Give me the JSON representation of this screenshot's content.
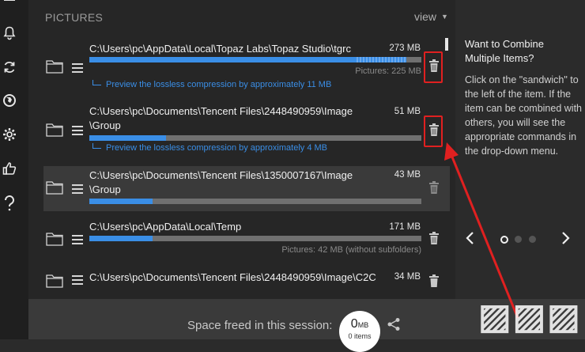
{
  "section": {
    "title": "PICTURES",
    "view_label": "view"
  },
  "items": [
    {
      "path_line1": "C:\\Users\\pc\\AppData\\Local\\Topaz Labs\\Topaz Studio\\tgrc",
      "path_line2": "",
      "size": "273 MB",
      "sub": "Pictures: 225 MB",
      "preview": "Preview the lossless compression by approximately 11 MB",
      "progress": 0.955
    },
    {
      "path_line1": "C:\\Users\\pc\\Documents\\Tencent Files\\2448490959\\Image",
      "path_line2": "\\Group",
      "size": "51 MB",
      "sub": "",
      "preview": "Preview the lossless compression by approximately 4 MB",
      "progress": 0.23
    },
    {
      "path_line1": "C:\\Users\\pc\\Documents\\Tencent Files\\1350007167\\Image",
      "path_line2": "\\Group",
      "size": "43 MB",
      "sub": "",
      "preview": "",
      "progress": 0.19
    },
    {
      "path_line1": "C:\\Users\\pc\\AppData\\Local\\Temp",
      "path_line2": "",
      "size": "171 MB",
      "sub": "Pictures: 42 MB (without subfolders)",
      "preview": "",
      "progress": 0.19
    },
    {
      "path_line1": "C:\\Users\\pc\\Documents\\Tencent Files\\2448490959\\Image\\C2C",
      "path_line2": "",
      "size": "34 MB",
      "sub": "",
      "preview": "",
      "progress": 0
    }
  ],
  "tip": {
    "title": "Want to Combine Multiple Items?",
    "body": "Click on the \"sandwich\" to the left of the item. If the item can be combined with others, you will see the appropriate commands in the drop-down menu."
  },
  "footer": {
    "label": "Space freed in this session:",
    "value": "0",
    "unit": "MB",
    "count": "0 items"
  },
  "sidebar_icons": [
    "menu-icon",
    "bell-icon",
    "refresh-icon",
    "globe-icon",
    "gear-icon",
    "thumbs-up-icon",
    "help-icon"
  ],
  "colors": {
    "accent": "#3a8ee6",
    "highlight": "#e02020"
  }
}
